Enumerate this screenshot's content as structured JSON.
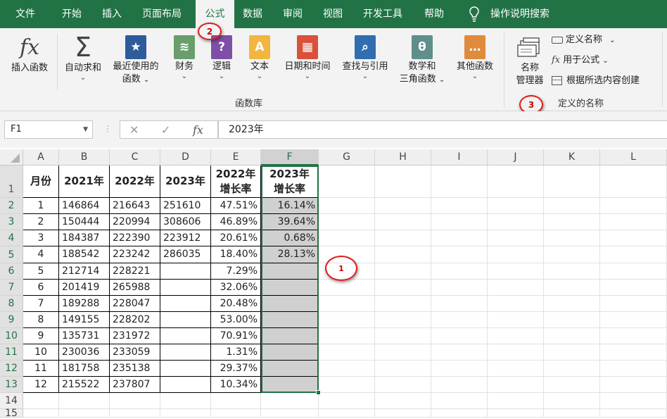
{
  "tabs": [
    "文件",
    "开始",
    "插入",
    "页面布局",
    "公式",
    "数据",
    "审阅",
    "视图",
    "开发工具",
    "帮助"
  ],
  "active_tab": "公式",
  "search_label": "操作说明搜索",
  "ribbon": {
    "insert_function": "插入函数",
    "autosum": "自动求和",
    "recent_1": "最近使用的",
    "recent_2": "函数",
    "financial": "财务",
    "logical": "逻辑",
    "text": "文本",
    "datetime": "日期和时间",
    "lookup": "查找与引用",
    "math_1": "数学和",
    "math_2": "三角函数",
    "more": "其他函数",
    "group_library": "函数库",
    "name_manager_1": "名称",
    "name_manager_2": "管理器",
    "define_name": "定义名称",
    "use_in_formula": "用于公式",
    "create_from_selection": "根据所选内容创建",
    "group_defined_names": "定义的名称"
  },
  "annotations": {
    "c1": "1",
    "c2": "2",
    "c3": "3"
  },
  "formula_bar": {
    "name_box": "F1",
    "formula": "2023年",
    "cancel": "✕",
    "enter": "✓",
    "fx": "fx"
  },
  "colors": {
    "green": "#217346",
    "annotation_red": "#e21b1b",
    "selection_fill": "#d0d0d0"
  },
  "sheet": {
    "columns": [
      "A",
      "B",
      "C",
      "D",
      "E",
      "F",
      "G",
      "H",
      "I",
      "J",
      "K",
      "L"
    ],
    "selected_column": "F",
    "row_numbers": [
      "1",
      "2",
      "3",
      "4",
      "5",
      "6",
      "7",
      "8",
      "9",
      "10",
      "11",
      "12",
      "13",
      "14",
      "15"
    ],
    "headers": [
      "月份",
      "2021年",
      "2022年",
      "2023年",
      "2022年\n增长率",
      "2023年\n增长率"
    ],
    "rows": [
      [
        "1",
        "146864",
        "216643",
        "251610",
        "47.51%",
        "16.14%"
      ],
      [
        "2",
        "150444",
        "220994",
        "308606",
        "46.89%",
        "39.64%"
      ],
      [
        "3",
        "184387",
        "222390",
        "223912",
        "20.61%",
        "0.68%"
      ],
      [
        "4",
        "188542",
        "223242",
        "286035",
        "18.40%",
        "28.13%"
      ],
      [
        "5",
        "212714",
        "228221",
        "",
        "7.29%",
        ""
      ],
      [
        "6",
        "201419",
        "265988",
        "",
        "32.06%",
        ""
      ],
      [
        "7",
        "189288",
        "228047",
        "",
        "20.48%",
        ""
      ],
      [
        "8",
        "149155",
        "228202",
        "",
        "53.00%",
        ""
      ],
      [
        "9",
        "135731",
        "231972",
        "",
        "70.91%",
        ""
      ],
      [
        "10",
        "230036",
        "233059",
        "",
        "1.31%",
        ""
      ],
      [
        "11",
        "181758",
        "235138",
        "",
        "29.37%",
        ""
      ],
      [
        "12",
        "215522",
        "237807",
        "",
        "10.34%",
        ""
      ]
    ]
  }
}
